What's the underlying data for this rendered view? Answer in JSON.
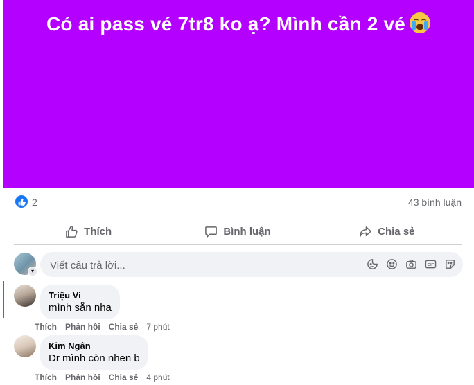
{
  "post": {
    "banner_text": "Có ai pass vé 7tr8 ko ạ? Mình cần 2 vé",
    "banner_color": "#b300ff",
    "emoji": "loudly-crying-face-emoji"
  },
  "stats": {
    "like_count": "2",
    "comment_count": "43 bình luận"
  },
  "actions": {
    "like_label": "Thích",
    "comment_label": "Bình luận",
    "share_label": "Chia sẻ"
  },
  "composer": {
    "placeholder": "Viết câu trả lời...",
    "icons": [
      "sticker-icon",
      "emoji-icon",
      "camera-icon",
      "gif-icon",
      "avatar-sticker-icon"
    ]
  },
  "comments": [
    {
      "name": "Triệu Vi",
      "text": "mình sẵn nha",
      "like": "Thích",
      "reply": "Phản hồi",
      "share": "Chia sẻ",
      "time": "7 phút"
    },
    {
      "name": "Kim Ngân",
      "text": "Dr mình còn nhen b",
      "like": "Thích",
      "reply": "Phản hồi",
      "share": "Chia sẻ",
      "time": "4 phút"
    }
  ],
  "colors": {
    "accent": "#1877f2",
    "secondary_text": "#65676b",
    "input_bg": "#f0f2f5"
  }
}
